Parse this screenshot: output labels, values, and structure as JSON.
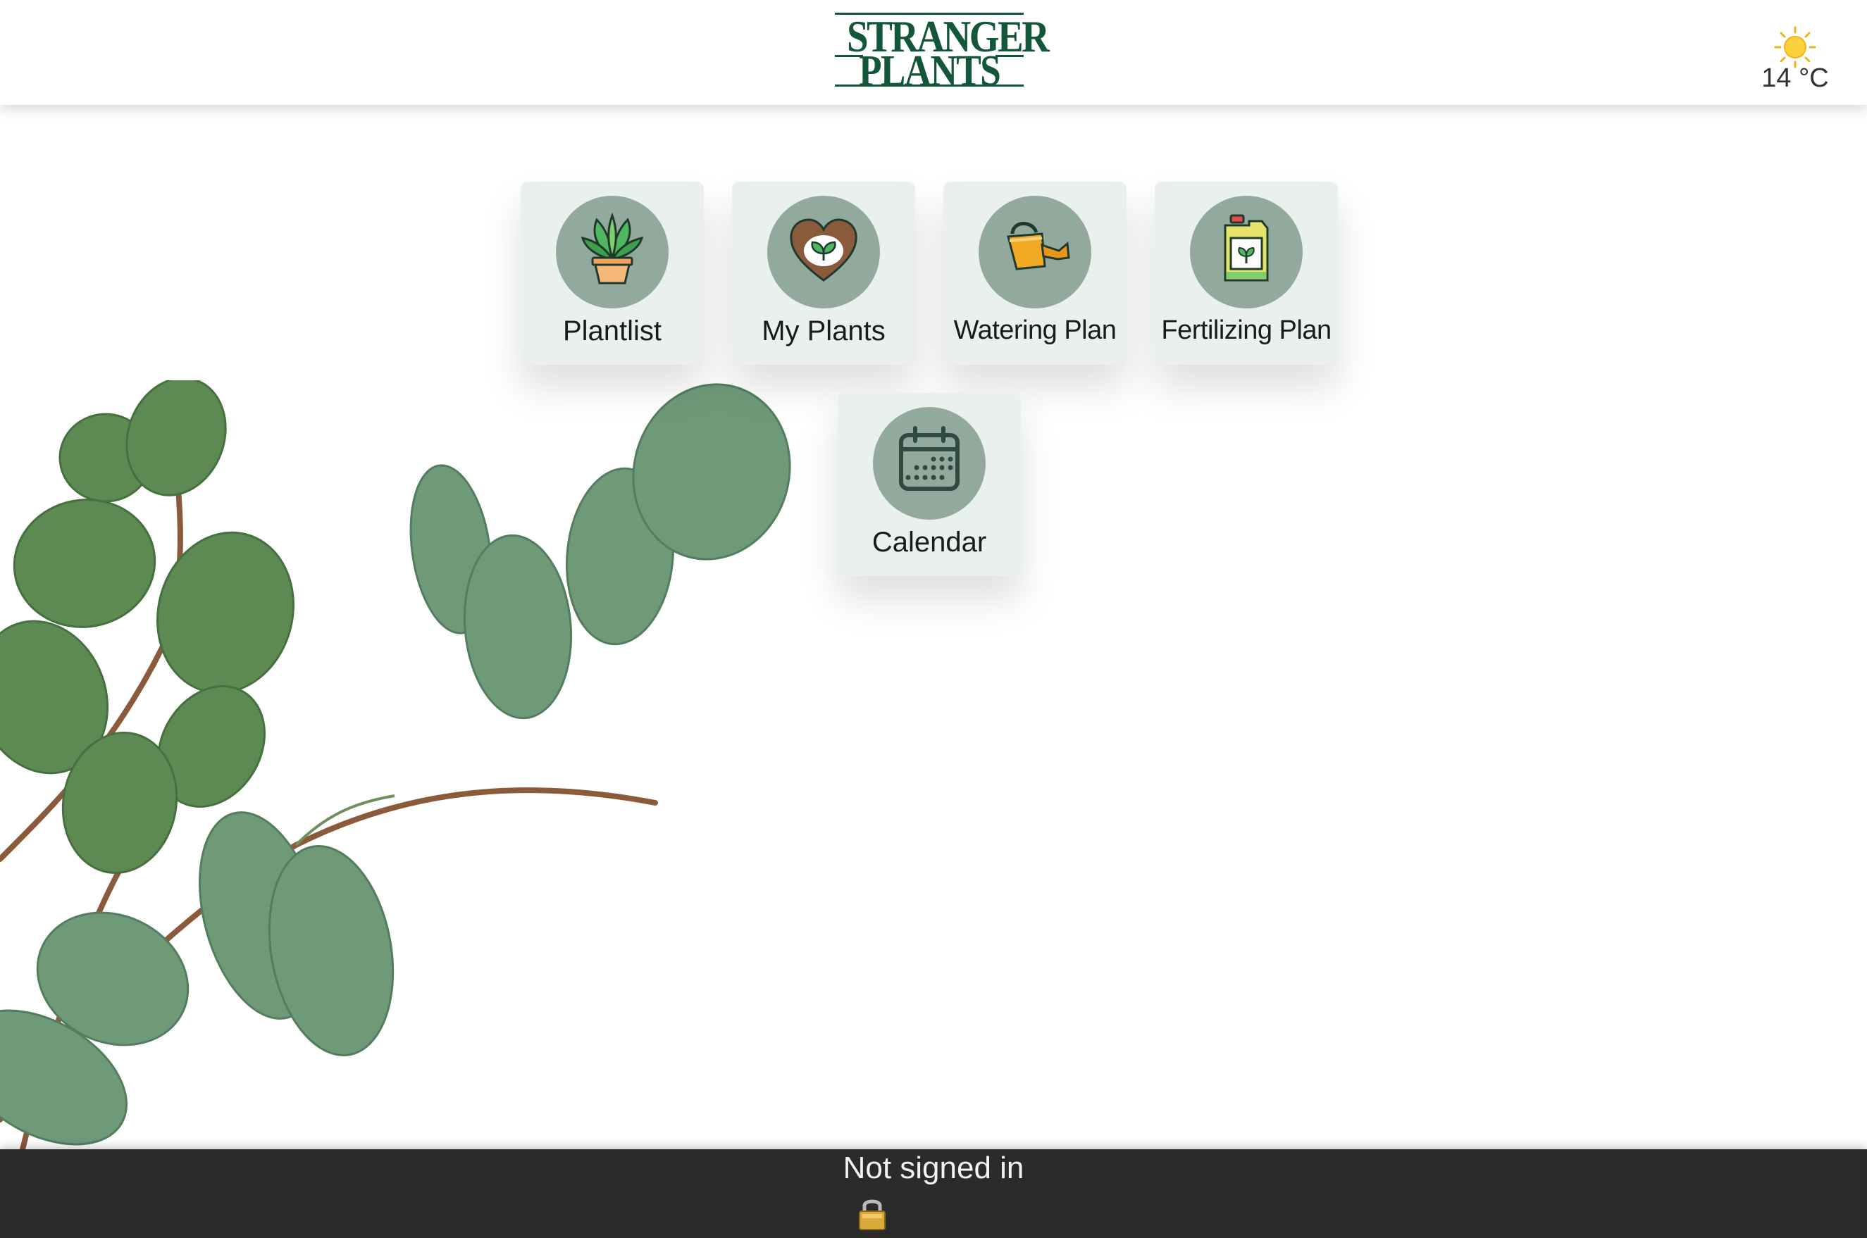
{
  "header": {
    "logo": {
      "line1": "STRANGER",
      "line2": "PLANTS"
    },
    "weather": {
      "icon": "sun-icon",
      "temperature": "14 °C"
    }
  },
  "menu": {
    "tiles": [
      {
        "label": "Plantlist",
        "icon": "potted-plant-icon"
      },
      {
        "label": "My Plants",
        "icon": "heart-sprout-icon"
      },
      {
        "label": "Watering Plan",
        "icon": "watering-can-icon"
      },
      {
        "label": "Fertilizing Plan",
        "icon": "fertilizer-bottle-icon"
      },
      {
        "label": "Calendar",
        "icon": "calendar-icon"
      }
    ]
  },
  "footer": {
    "status": "Not signed in",
    "icon": "lock-icon"
  },
  "colors": {
    "brand_green": "#14563a",
    "tile_bg": "#e9f0ed",
    "icon_circle": "#92aa9d",
    "footer_bg": "#2b2b2b"
  }
}
